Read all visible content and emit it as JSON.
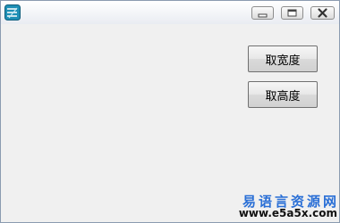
{
  "window": {
    "icon": "app-icon",
    "caption_buttons": [
      "minimize-icon",
      "maximize-icon",
      "close-icon"
    ]
  },
  "buttons": {
    "get_width": "取宽度",
    "get_height": "取高度"
  },
  "watermark": {
    "title": "易语言资源网",
    "url": "www.e5a5x.com"
  },
  "colors": {
    "watermark_title": "#2a6fd6",
    "client_background": "#f0f0f0"
  }
}
